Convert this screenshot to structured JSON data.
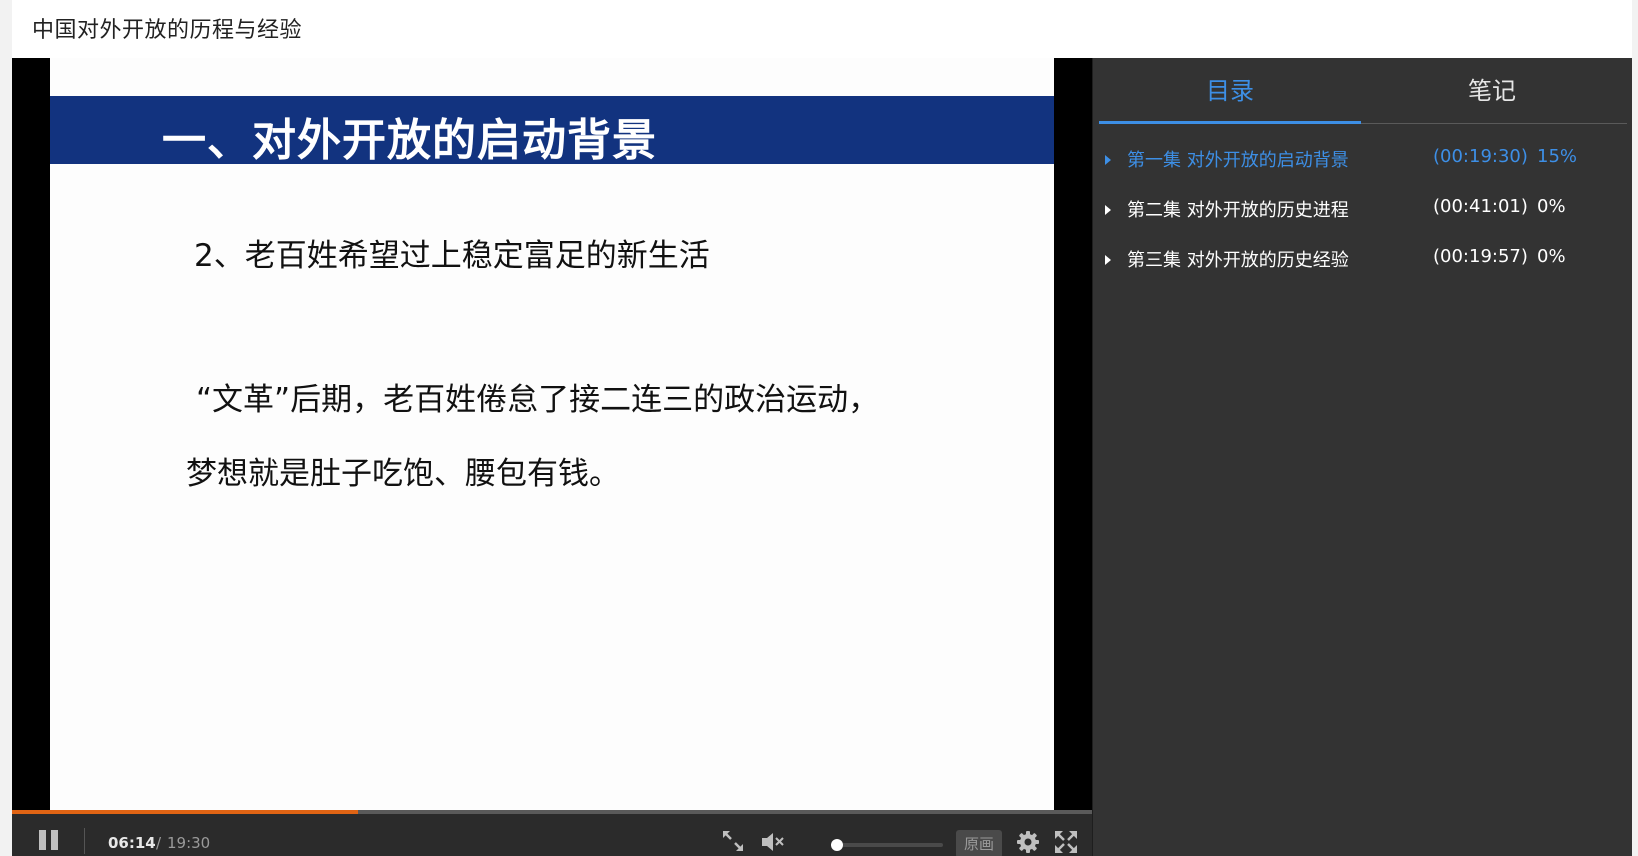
{
  "page": {
    "title": "中国对外开放的历程与经验"
  },
  "slide": {
    "title": "一、对外开放的启动背景",
    "subtitle": "2、老百姓希望过上稳定富足的新生活",
    "body_line_1": "“文革”后期，老百姓倦怠了接二连三的政治运动，",
    "body_line_2": "梦想就是肚子吃饱、腰包有钱。"
  },
  "player": {
    "current_time": "06:14",
    "separator": "/",
    "total_time": "19:30",
    "progress_fraction": 0.32,
    "volume_fraction": 0.0,
    "muted": true,
    "quality_label": "原画",
    "colors": {
      "progress": "#e06414",
      "accent": "#3d8fe6"
    },
    "icons": [
      "pause-icon",
      "mini-player-icon",
      "volume-muted-icon",
      "settings-gear-icon",
      "fullscreen-icon"
    ]
  },
  "sidebar": {
    "tabs": [
      {
        "label": "目录",
        "active": true
      },
      {
        "label": "笔记",
        "active": false
      }
    ],
    "episodes": [
      {
        "title": "第一集 对外开放的启动背景",
        "duration": "(00:19:30)",
        "progress": "15%",
        "active": true
      },
      {
        "title": "第二集 对外开放的历史进程",
        "duration": "(00:41:01)",
        "progress": "0%",
        "active": false
      },
      {
        "title": "第三集 对外开放的历史经验",
        "duration": "(00:19:57)",
        "progress": "0%",
        "active": false
      }
    ]
  }
}
